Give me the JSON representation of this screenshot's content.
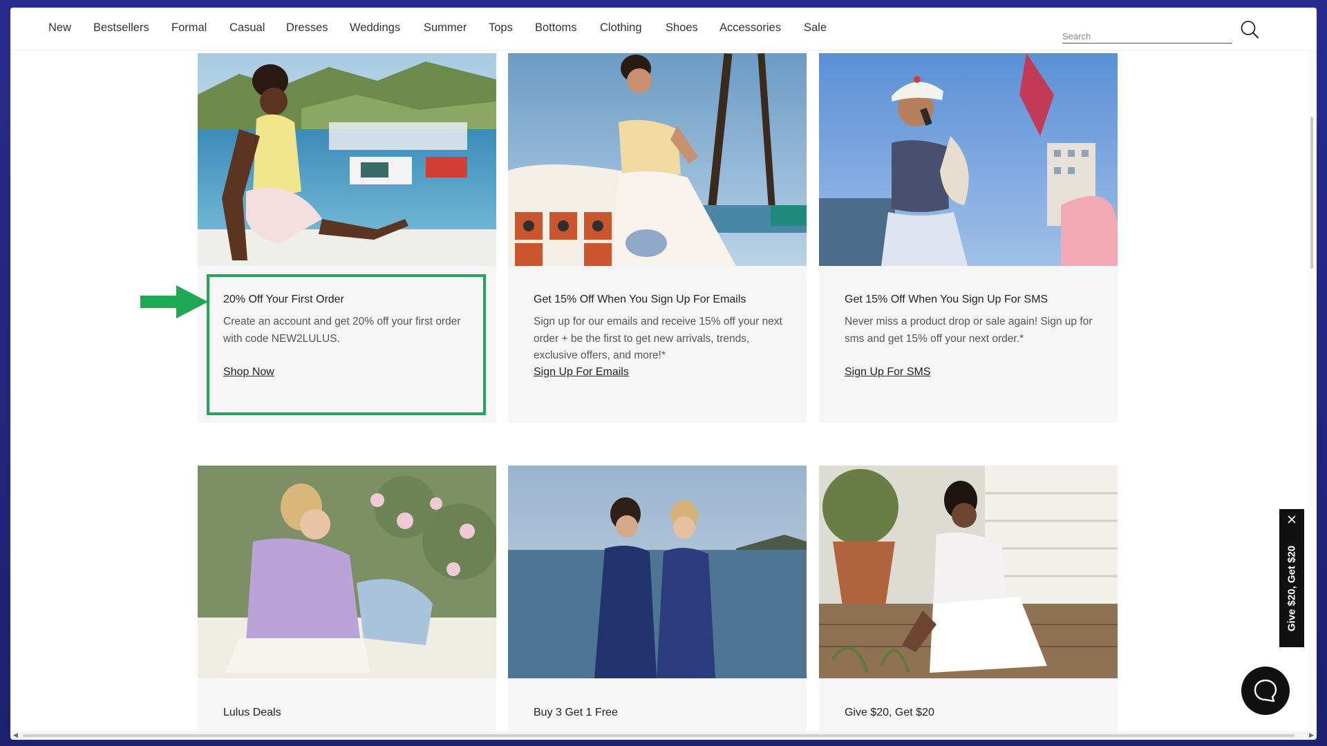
{
  "nav": {
    "items": [
      "New",
      "Bestsellers",
      "Formal",
      "Casual",
      "Dresses",
      "Weddings",
      "Summer",
      "Tops",
      "Bottoms",
      "Clothing",
      "Shoes",
      "Accessories",
      "Sale"
    ],
    "search_placeholder": "Search",
    "icons": {
      "search": "search-icon"
    }
  },
  "cards": [
    {
      "title": "20% Off Your First Order",
      "text": "Create an account and get 20% off your first order with code NEW2LULUS.",
      "link": "Shop Now"
    },
    {
      "title": "Get 15% Off When You Sign Up For Emails",
      "text": "Sign up for our emails and receive 15% off your next order + be the first to get new arrivals, trends, exclusive offers, and more!*",
      "link": "Sign Up For Emails"
    },
    {
      "title": "Get 15% Off When You Sign Up For SMS",
      "text": "Never miss a product drop or sale again! Sign up for sms and get 15% off your next order.*",
      "link": "Sign Up For SMS"
    },
    {
      "title": "Lulus Deals"
    },
    {
      "title": "Buy 3 Get 1 Free"
    },
    {
      "title": "Give $20, Get $20"
    }
  ],
  "referral_tab": {
    "label": "Give $20, Get $20"
  },
  "colors": {
    "highlight": "#1fa855",
    "accent_dark": "#111111",
    "frame": "#272b8c"
  }
}
